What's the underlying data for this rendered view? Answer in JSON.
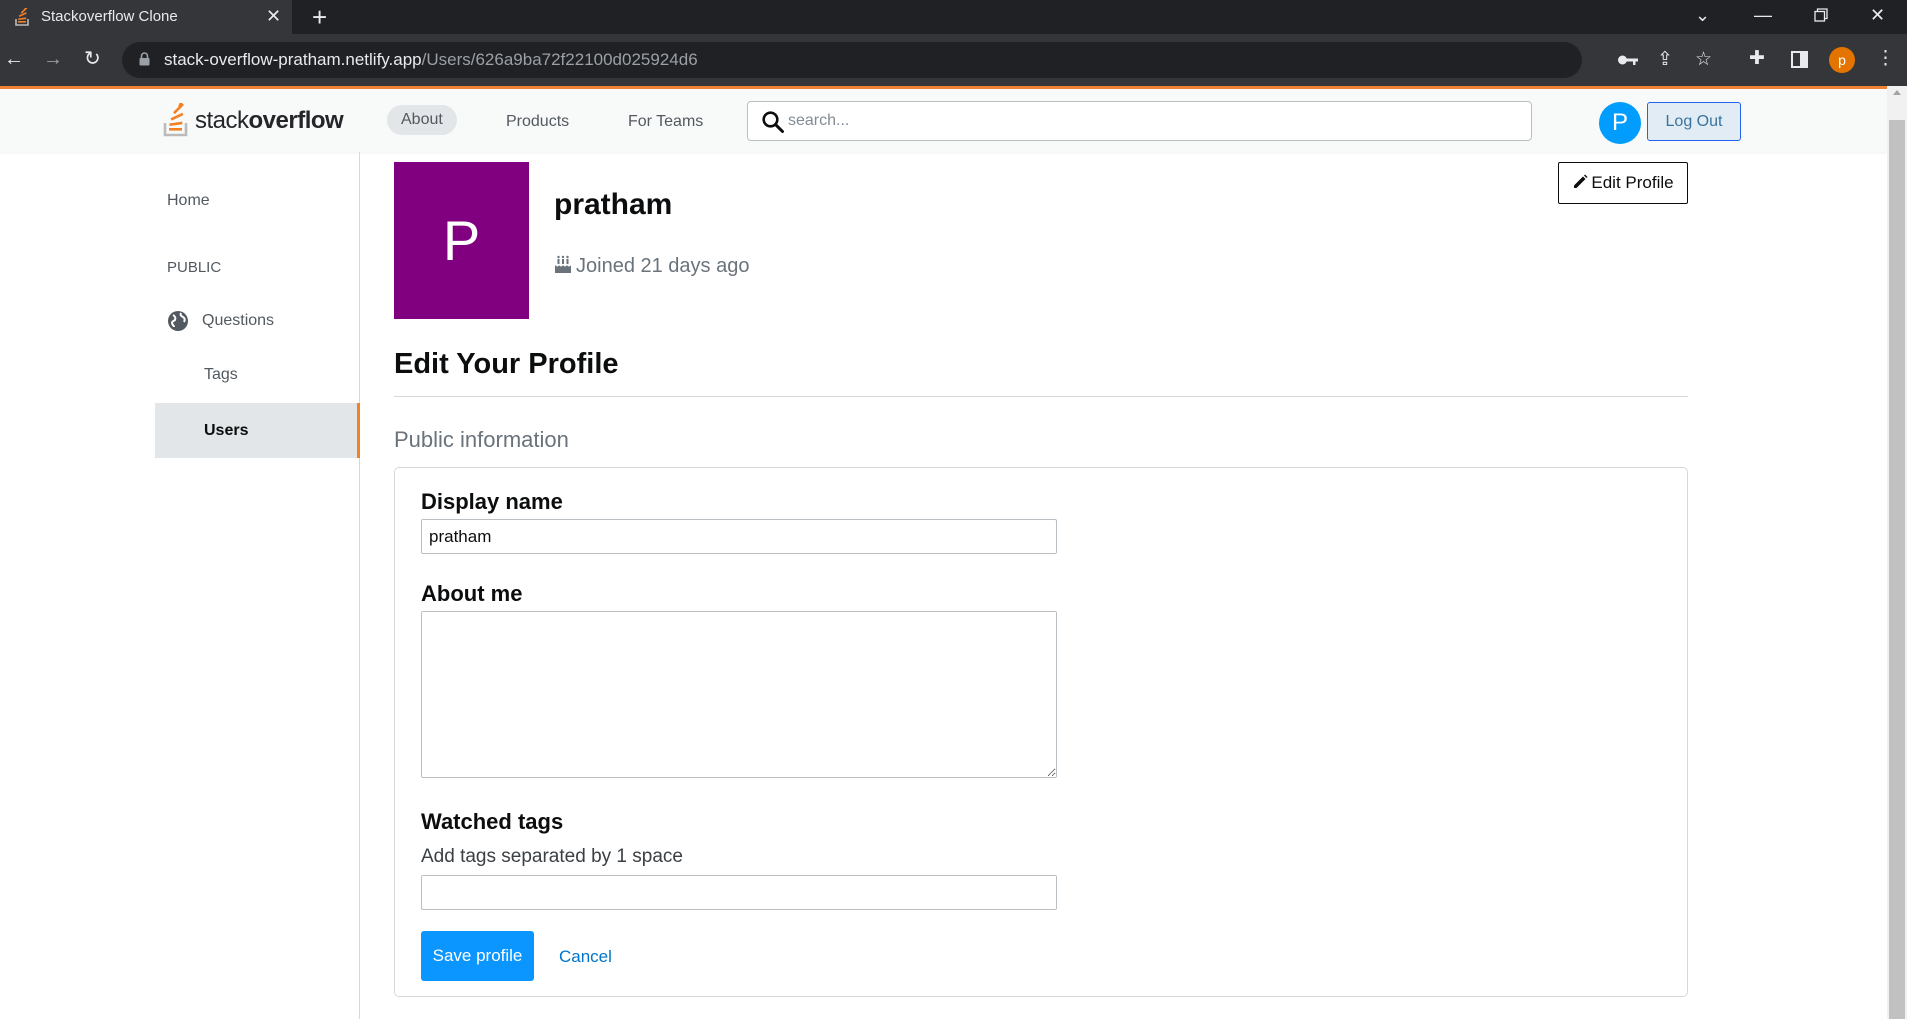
{
  "browser": {
    "tab_title": "Stackoverflow Clone",
    "tab_close": "✕",
    "new_tab": "+",
    "url_host": "stack-overflow-pratham.netlify.app",
    "url_path": "/Users/626a9ba72f22100d025924d6",
    "profile_initial": "p"
  },
  "nav": {
    "logo_light": "stack",
    "logo_bold": "overflow",
    "links": [
      "About",
      "Products",
      "For Teams"
    ],
    "search_placeholder": "search...",
    "avatar_initial": "P",
    "logout_label": "Log Out"
  },
  "sidebar": {
    "home": "Home",
    "section": "PUBLIC",
    "questions": "Questions",
    "tags": "Tags",
    "users": "Users"
  },
  "profile": {
    "avatar_initial": "P",
    "name": "pratham",
    "joined": "Joined 21 days ago",
    "edit_button": "Edit Profile"
  },
  "form": {
    "heading": "Edit Your Profile",
    "section": "Public information",
    "display_name_label": "Display name",
    "display_name_value": "pratham",
    "about_label": "About me",
    "about_value": "",
    "tags_label": "Watched tags",
    "tags_hint": "Add tags separated by 1 space",
    "tags_value": "",
    "save_button": "Save profile",
    "cancel_button": "Cancel"
  },
  "colors": {
    "brand_orange": "#f48225",
    "avatar_purple": "#800080",
    "avatar_blue": "#009dff",
    "primary_button": "#0a95ff"
  }
}
